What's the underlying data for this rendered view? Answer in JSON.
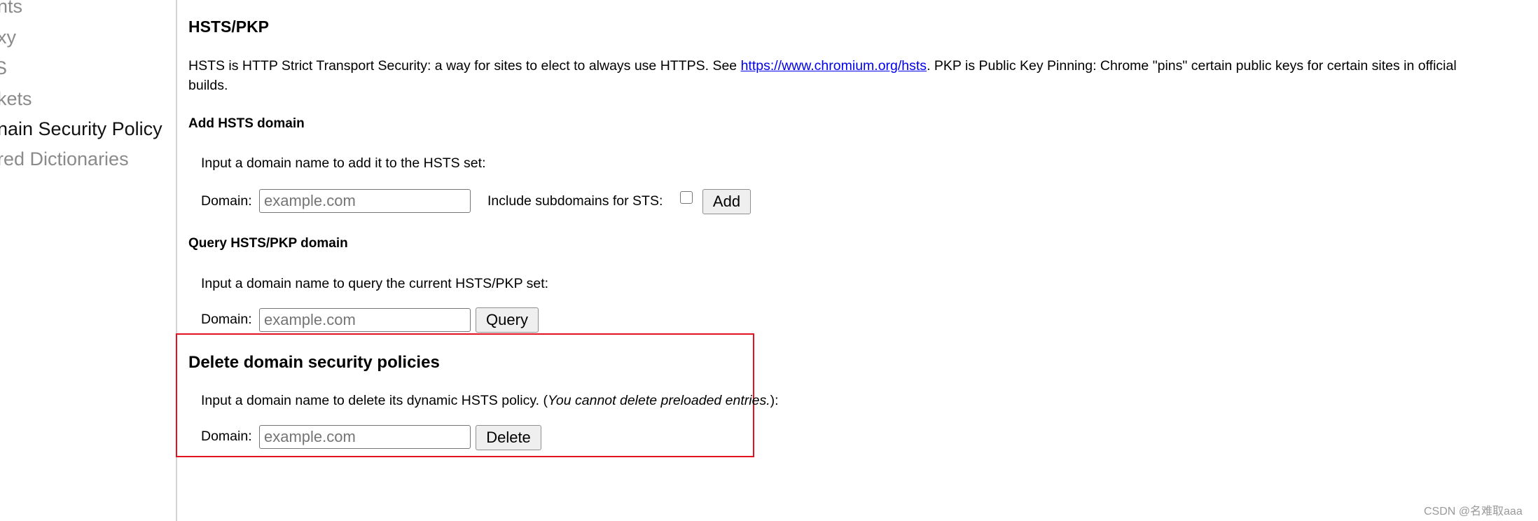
{
  "sidebar": {
    "items": [
      {
        "label": "nts",
        "selected": false
      },
      {
        "label": "xy",
        "selected": false
      },
      {
        "label": "S",
        "selected": false
      },
      {
        "label": "kets",
        "selected": false
      },
      {
        "label": "nain Security Policy",
        "selected": true
      },
      {
        "label": "red Dictionaries",
        "selected": false
      }
    ]
  },
  "main": {
    "title": "HSTS/PKP",
    "intro_before_link": "HSTS is HTTP Strict Transport Security: a way for sites to elect to always use HTTPS. See ",
    "intro_link": "https://www.chromium.org/hsts",
    "intro_after_link": ". PKP is Public Key Pinning: Chrome \"pins\" certain public keys for certain sites in official",
    "intro_line2": "builds.",
    "add": {
      "heading": "Add HSTS domain",
      "description": "Input a domain name to add it to the HSTS set:",
      "domain_label": "Domain:",
      "placeholder": "example.com",
      "subdomains_label": "Include subdomains for STS:",
      "subdomains_checked": false,
      "button": "Add"
    },
    "query": {
      "heading": "Query HSTS/PKP domain",
      "description": "Input a domain name to query the current HSTS/PKP set:",
      "domain_label": "Domain:",
      "placeholder": "example.com",
      "button": "Query"
    },
    "delete": {
      "heading": "Delete domain security policies",
      "description": "Input a domain name to delete its dynamic HSTS policy. (",
      "description_italic": "You cannot delete preloaded entries.",
      "description_end": "):",
      "domain_label": "Domain:",
      "placeholder": "example.com",
      "button": "Delete"
    }
  },
  "annotation": {
    "highlight_color": "#e0131e"
  },
  "watermark": "CSDN @名难取aaa"
}
